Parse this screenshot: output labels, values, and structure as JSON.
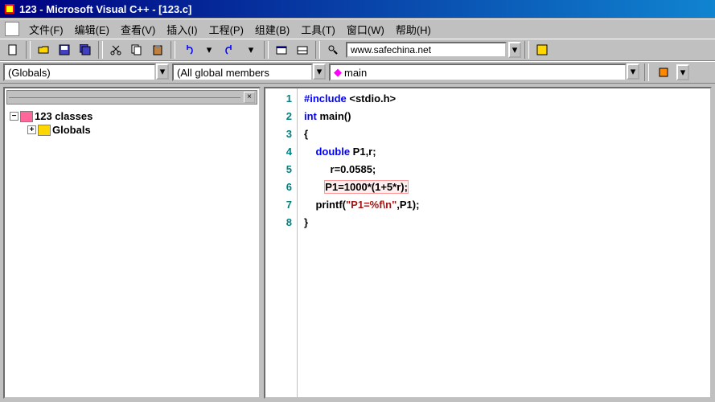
{
  "title": "123 - Microsoft Visual C++ - [123.c]",
  "menu": {
    "file": "文件(F)",
    "edit": "编辑(E)",
    "view": "查看(V)",
    "insert": "插入(I)",
    "project": "工程(P)",
    "build": "组建(B)",
    "tools": "工具(T)",
    "window": "窗口(W)",
    "help": "帮助(H)"
  },
  "url_box": "www.safechina.net",
  "combos": {
    "scope": "(Globals)",
    "filter": "(All global members",
    "func": "main"
  },
  "classview": {
    "root": "123 classes",
    "child": "Globals"
  },
  "code": {
    "lines": [
      "1",
      "2",
      "3",
      "4",
      "5",
      "6",
      "7",
      "8"
    ],
    "l1_a": "#include",
    "l1_b": " <stdio.h>",
    "l2_a": "int",
    "l2_b": " main()",
    "l3": "{",
    "l4_a": "    double",
    "l4_b": " P1,r;",
    "l5": "         r=0.0585;",
    "l6_a": "       ",
    "l6_b": "P1=1000*(1+5*r);",
    "l7_a": "    printf(",
    "l7_b": "\"P1=%f\\n\"",
    "l7_c": ",P1);",
    "l8": "}"
  }
}
